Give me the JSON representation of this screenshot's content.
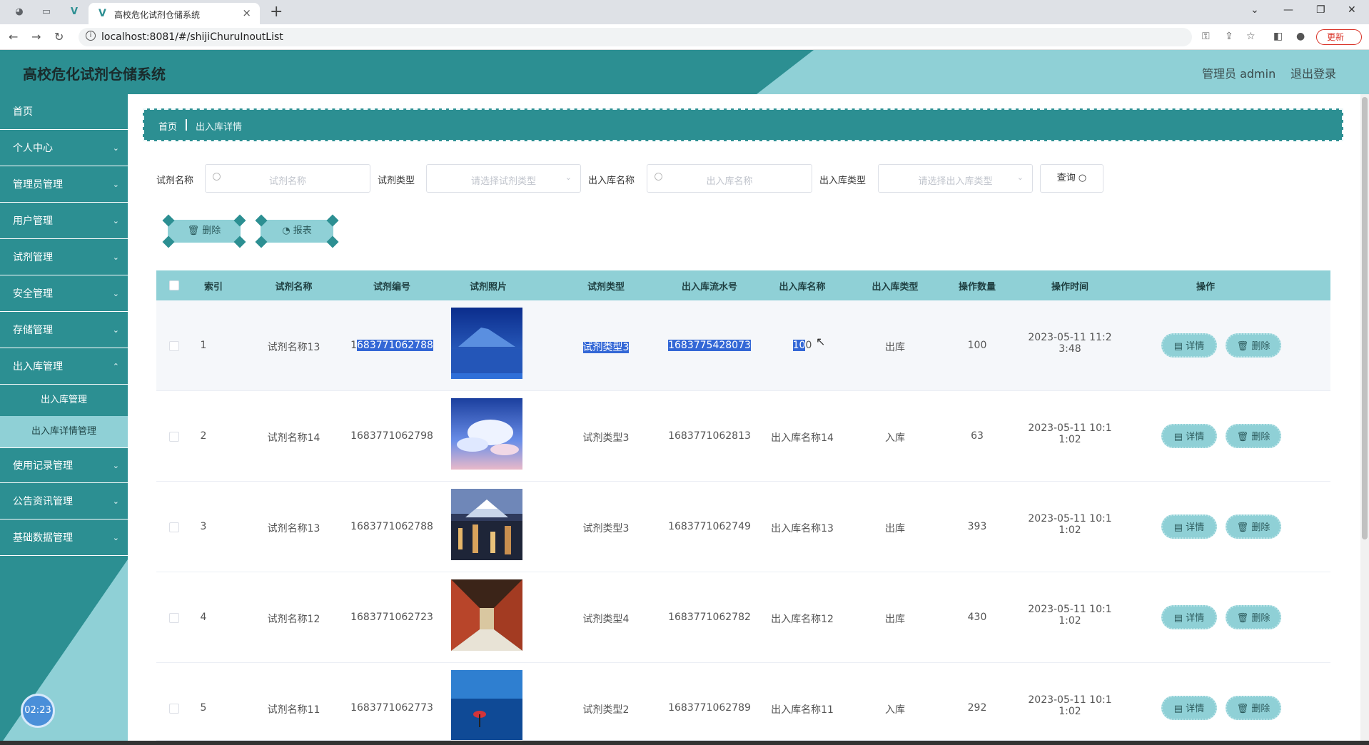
{
  "browser": {
    "tab_title": "高校危化试剂仓储系统",
    "url": "localhost:8081/#/shijiChuruInoutList",
    "update_label": "更新"
  },
  "header": {
    "title": "高校危化试剂仓储系统",
    "admin": "管理员 admin",
    "logout": "退出登录"
  },
  "sidebar": {
    "items": [
      {
        "label": "首页",
        "expandable": false
      },
      {
        "label": "个人中心",
        "expandable": true
      },
      {
        "label": "管理员管理",
        "expandable": true
      },
      {
        "label": "用户管理",
        "expandable": true
      },
      {
        "label": "试剂管理",
        "expandable": true
      },
      {
        "label": "安全管理",
        "expandable": true
      },
      {
        "label": "存储管理",
        "expandable": true
      },
      {
        "label": "出入库管理",
        "expandable": true
      }
    ],
    "sub_items": [
      "出入库管理",
      "出入库详情管理"
    ],
    "items_after": [
      {
        "label": "使用记录管理"
      },
      {
        "label": "公告资讯管理"
      },
      {
        "label": "基础数据管理"
      }
    ],
    "timer": "02:23"
  },
  "breadcrumb": {
    "home": "首页",
    "current": "出入库详情"
  },
  "search": {
    "name_label": "试剂名称",
    "name_placeholder": "试剂名称",
    "type_label": "试剂类型",
    "type_placeholder": "请选择试剂类型",
    "inout_name_label": "出入库名称",
    "inout_name_placeholder": "出入库名称",
    "inout_type_label": "出入库类型",
    "inout_type_placeholder": "请选择出入库类型",
    "query_label": "查询"
  },
  "actions": {
    "delete": "删除",
    "report": "报表"
  },
  "table": {
    "headers": [
      "索引",
      "试剂名称",
      "试剂编号",
      "试剂照片",
      "试剂类型",
      "出入库流水号",
      "出入库名称",
      "出入库类型",
      "操作数量",
      "操作时间",
      "操作"
    ],
    "detail_label": "详情",
    "delete_label": "删除",
    "rows": [
      {
        "index": "1",
        "name": "试剂名称13",
        "code_a": "1",
        "code_b": "683771062788",
        "type": "试剂类型3",
        "serial": "1683775428073",
        "inout_name_a": "10",
        "inout_name_b": "0",
        "inout_type": "出库",
        "qty": "100",
        "time1": "2023-05-11 11:2",
        "time2": "3:48",
        "photo": "photo-mountain-night"
      },
      {
        "index": "2",
        "name": "试剂名称14",
        "code": "1683771062798",
        "type": "试剂类型3",
        "serial": "1683771062813",
        "inout_name": "出入库名称14",
        "inout_type": "入库",
        "qty": "63",
        "time1": "2023-05-11 10:1",
        "time2": "1:02",
        "photo": "photo-clouds"
      },
      {
        "index": "3",
        "name": "试剂名称13",
        "code": "1683771062788",
        "type": "试剂类型3",
        "serial": "1683771062749",
        "inout_name": "出入库名称13",
        "inout_type": "出库",
        "qty": "393",
        "time1": "2023-05-11 10:1",
        "time2": "1:02",
        "photo": "photo-city-fuji"
      },
      {
        "index": "4",
        "name": "试剂名称12",
        "code": "1683771062723",
        "type": "试剂类型4",
        "serial": "1683771062782",
        "inout_name": "出入库名称12",
        "inout_type": "出库",
        "qty": "430",
        "time1": "2023-05-11 10:1",
        "time2": "1:02",
        "photo": "photo-corridor"
      },
      {
        "index": "5",
        "name": "试剂名称11",
        "code": "1683771062773",
        "type": "试剂类型2",
        "serial": "1683771062789",
        "inout_name": "出入库名称11",
        "inout_type": "入库",
        "qty": "292",
        "time1": "2023-05-11 10:1",
        "time2": "1:02",
        "photo": "photo-sea-umbrella"
      }
    ]
  },
  "colors": {
    "primary": "#2c8f92",
    "light": "#8fd0d6",
    "selection": "#3367d6"
  }
}
